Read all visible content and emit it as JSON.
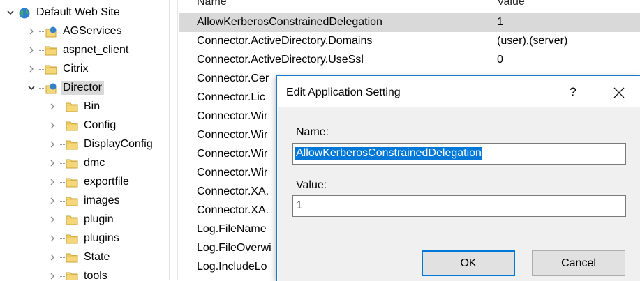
{
  "tree": {
    "site": {
      "label": "Default Web Site",
      "icon": "globe-icon"
    },
    "items": [
      {
        "label": "AGServices",
        "icon": "web-app-icon"
      },
      {
        "label": "aspnet_client",
        "icon": "folder-icon"
      },
      {
        "label": "Citrix",
        "icon": "folder-icon"
      },
      {
        "label": "Director",
        "icon": "web-app-icon"
      },
      {
        "label": "Bin",
        "icon": "folder-icon"
      },
      {
        "label": "Config",
        "icon": "folder-icon"
      },
      {
        "label": "DisplayConfig",
        "icon": "folder-icon"
      },
      {
        "label": "dmc",
        "icon": "folder-icon"
      },
      {
        "label": "exportfile",
        "icon": "folder-icon"
      },
      {
        "label": "images",
        "icon": "folder-icon"
      },
      {
        "label": "plugin",
        "icon": "folder-icon"
      },
      {
        "label": "plugins",
        "icon": "folder-icon"
      },
      {
        "label": "State",
        "icon": "folder-icon"
      },
      {
        "label": "tools",
        "icon": "folder-icon"
      }
    ]
  },
  "grid": {
    "columns": [
      "Name",
      "Value"
    ],
    "rows": [
      {
        "name": "AllowKerberosConstrainedDelegation",
        "value": "1"
      },
      {
        "name": "Connector.ActiveDirectory.Domains",
        "value": "(user),(server)"
      },
      {
        "name": "Connector.ActiveDirectory.UseSsl",
        "value": "0"
      },
      {
        "name": "Connector.Cer",
        "value": ""
      },
      {
        "name": "Connector.Lic",
        "value": ""
      },
      {
        "name": "Connector.Wir",
        "value": ""
      },
      {
        "name": "Connector.Wir",
        "value": ""
      },
      {
        "name": "Connector.Wir",
        "value": ""
      },
      {
        "name": "Connector.Wir",
        "value": ""
      },
      {
        "name": "Connector.XA.",
        "value": ""
      },
      {
        "name": "Connector.XA.",
        "value": ""
      },
      {
        "name": "Log.FileName",
        "value": ""
      },
      {
        "name": "Log.FileOverwi",
        "value": ""
      },
      {
        "name": "Log.IncludeLo",
        "value": ""
      }
    ]
  },
  "dialog": {
    "title": "Edit Application Setting",
    "help": "?",
    "name_label": "Name:",
    "name_value": "AllowKerberosConstrainedDelegation",
    "value_label": "Value:",
    "value_value": "1",
    "ok_label": "OK",
    "cancel_label": "Cancel"
  },
  "colors": {
    "selection": "#0078d7",
    "accent_border": "#1979ca",
    "row_selected": "#d9d9d9"
  }
}
